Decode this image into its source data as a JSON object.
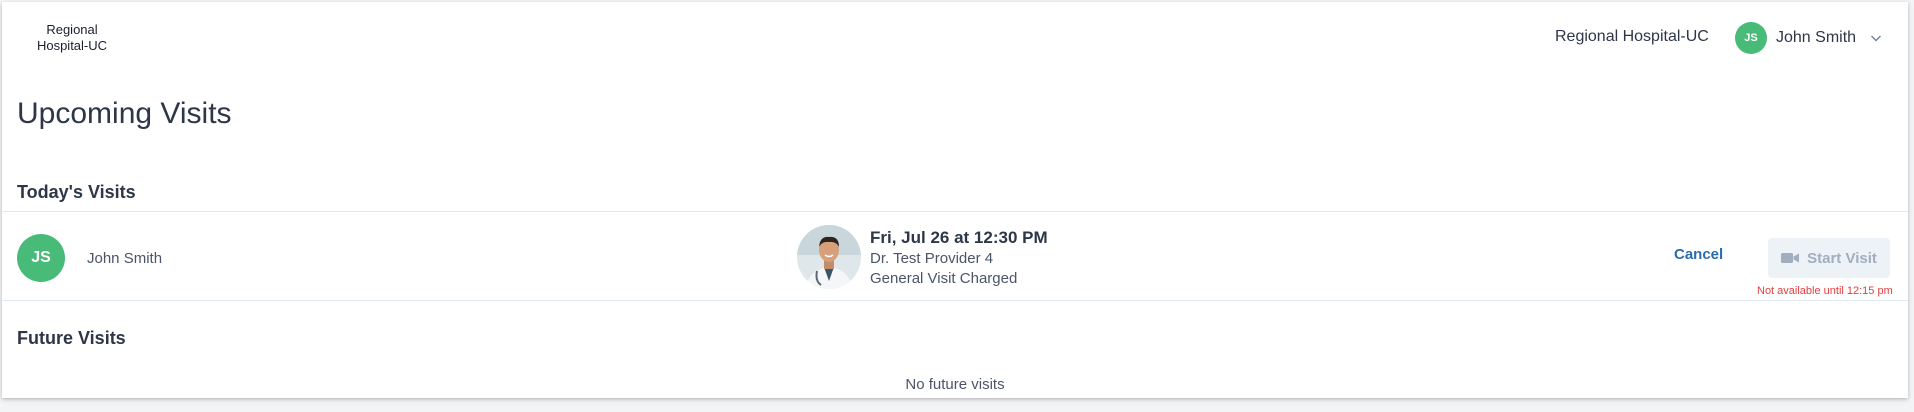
{
  "header": {
    "logo_line1": "Regional",
    "logo_line2": "Hospital-UC",
    "organization": "Regional Hospital-UC",
    "user": {
      "initials": "JS",
      "name": "John Smith"
    }
  },
  "page": {
    "title": "Upcoming Visits"
  },
  "today": {
    "section_title": "Today's Visits",
    "visit": {
      "patient_initials": "JS",
      "patient_name": "John Smith",
      "date_time": "Fri, Jul 26 at 12:30 PM",
      "provider": "Dr. Test Provider 4",
      "visit_type": "General Visit Charged",
      "cancel_label": "Cancel",
      "start_label": "Start Visit",
      "availability_note": "Not available until 12:15 pm"
    }
  },
  "future": {
    "section_title": "Future Visits",
    "empty_message": "No future visits"
  },
  "colors": {
    "avatar": "#48bb78",
    "link": "#2b6cb0",
    "warning": "#e53e3e",
    "disabled_button_bg": "#edf2f7"
  },
  "icons": [
    "chevron-down-icon",
    "video-camera-icon",
    "provider-photo"
  ]
}
